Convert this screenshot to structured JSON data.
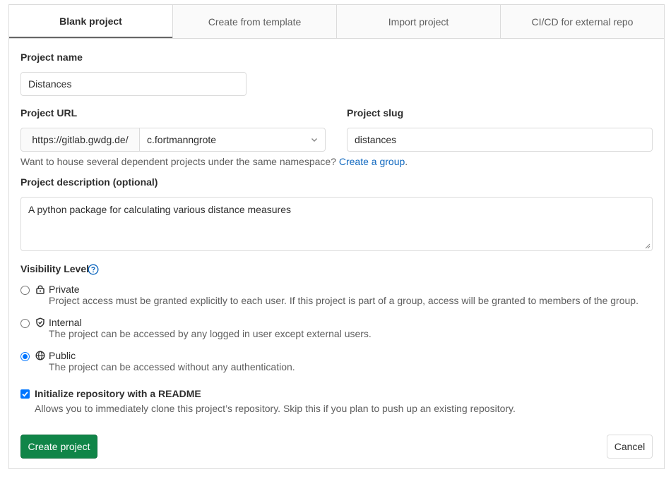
{
  "tabs": [
    {
      "label": "Blank project",
      "active": true
    },
    {
      "label": "Create from template",
      "active": false
    },
    {
      "label": "Import project",
      "active": false
    },
    {
      "label": "CI/CD for external repo",
      "active": false
    }
  ],
  "project_name": {
    "label": "Project name",
    "value": "Distances"
  },
  "project_url": {
    "label": "Project URL",
    "prefix": "https://gitlab.gwdg.de/",
    "namespace": "c.fortmanngrote"
  },
  "project_slug": {
    "label": "Project slug",
    "value": "distances"
  },
  "namespace_help": {
    "text": "Want to house several dependent projects under the same namespace? ",
    "link": "Create a group",
    "suffix": "."
  },
  "description": {
    "label": "Project description (optional)",
    "value": "A python package for calculating various distance measures"
  },
  "visibility": {
    "label": "Visibility Level",
    "options": [
      {
        "name": "Private",
        "description": "Project access must be granted explicitly to each user. If this project is part of a group, access will be granted to members of the group.",
        "icon": "lock-icon",
        "selected": false
      },
      {
        "name": "Internal",
        "description": "The project can be accessed by any logged in user except external users.",
        "icon": "shield-icon",
        "selected": false
      },
      {
        "name": "Public",
        "description": "The project can be accessed without any authentication.",
        "icon": "globe-icon",
        "selected": true
      }
    ]
  },
  "readme": {
    "label": "Initialize repository with a README",
    "help": "Allows you to immediately clone this project’s repository. Skip this if you plan to push up an existing repository.",
    "checked": true
  },
  "buttons": {
    "create": "Create project",
    "cancel": "Cancel"
  },
  "colors": {
    "primary": "#108548",
    "link": "#1068bf",
    "border": "#dbdbdb",
    "radio_checked": "#0075ff"
  }
}
